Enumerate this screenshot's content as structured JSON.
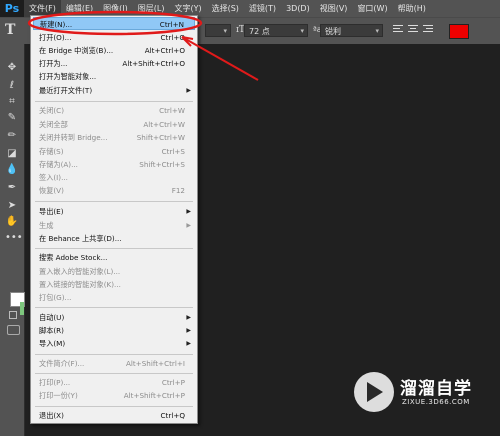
{
  "app": {
    "logo": "Ps"
  },
  "menubar": [
    "文件(F)",
    "编辑(E)",
    "图像(I)",
    "图层(L)",
    "文字(Y)",
    "选择(S)",
    "滤镜(T)",
    "3D(D)",
    "视图(V)",
    "窗口(W)",
    "帮助(H)"
  ],
  "options": {
    "font_size": "72 点",
    "antialias": "锐利",
    "text_color": "#ee0000"
  },
  "file_menu": [
    {
      "label": "新建(N)...",
      "shortcut": "Ctrl+N",
      "state": "highlight"
    },
    {
      "label": "打开(O)...",
      "shortcut": "Ctrl+O",
      "state": "normal"
    },
    {
      "label": "在 Bridge 中浏览(B)...",
      "shortcut": "Alt+Ctrl+O",
      "state": "normal"
    },
    {
      "label": "打开为...",
      "shortcut": "Alt+Shift+Ctrl+O",
      "state": "normal"
    },
    {
      "label": "打开为智能对象...",
      "shortcut": "",
      "state": "normal"
    },
    {
      "label": "最近打开文件(T)",
      "shortcut": "",
      "state": "submenu"
    },
    {
      "label": "关闭(C)",
      "shortcut": "Ctrl+W",
      "state": "disabled"
    },
    {
      "label": "关闭全部",
      "shortcut": "Alt+Ctrl+W",
      "state": "disabled"
    },
    {
      "label": "关闭并转到 Bridge...",
      "shortcut": "Shift+Ctrl+W",
      "state": "disabled"
    },
    {
      "label": "存储(S)",
      "shortcut": "Ctrl+S",
      "state": "disabled"
    },
    {
      "label": "存储为(A)...",
      "shortcut": "Shift+Ctrl+S",
      "state": "disabled"
    },
    {
      "label": "签入(I)...",
      "shortcut": "",
      "state": "disabled"
    },
    {
      "label": "恢复(V)",
      "shortcut": "F12",
      "state": "disabled"
    },
    {
      "label": "导出(E)",
      "shortcut": "",
      "state": "submenu"
    },
    {
      "label": "生成",
      "shortcut": "",
      "state": "disabled-submenu"
    },
    {
      "label": "在 Behance 上共享(D)...",
      "shortcut": "",
      "state": "normal"
    },
    {
      "label": "搜索 Adobe Stock...",
      "shortcut": "",
      "state": "normal"
    },
    {
      "label": "置入嵌入的智能对象(L)...",
      "shortcut": "",
      "state": "disabled"
    },
    {
      "label": "置入链接的智能对象(K)...",
      "shortcut": "",
      "state": "disabled"
    },
    {
      "label": "打包(G)...",
      "shortcut": "",
      "state": "disabled"
    },
    {
      "label": "自动(U)",
      "shortcut": "",
      "state": "submenu"
    },
    {
      "label": "脚本(R)",
      "shortcut": "",
      "state": "submenu"
    },
    {
      "label": "导入(M)",
      "shortcut": "",
      "state": "submenu"
    },
    {
      "label": "文件简介(F)...",
      "shortcut": "Alt+Shift+Ctrl+I",
      "state": "disabled"
    },
    {
      "label": "打印(P)...",
      "shortcut": "Ctrl+P",
      "state": "disabled"
    },
    {
      "label": "打印一份(Y)",
      "shortcut": "Alt+Shift+Ctrl+P",
      "state": "disabled"
    },
    {
      "label": "退出(X)",
      "shortcut": "Ctrl+Q",
      "state": "normal"
    }
  ],
  "watermark": {
    "title": "溜溜自学",
    "url": "ZIXUE.3D66.COM"
  }
}
